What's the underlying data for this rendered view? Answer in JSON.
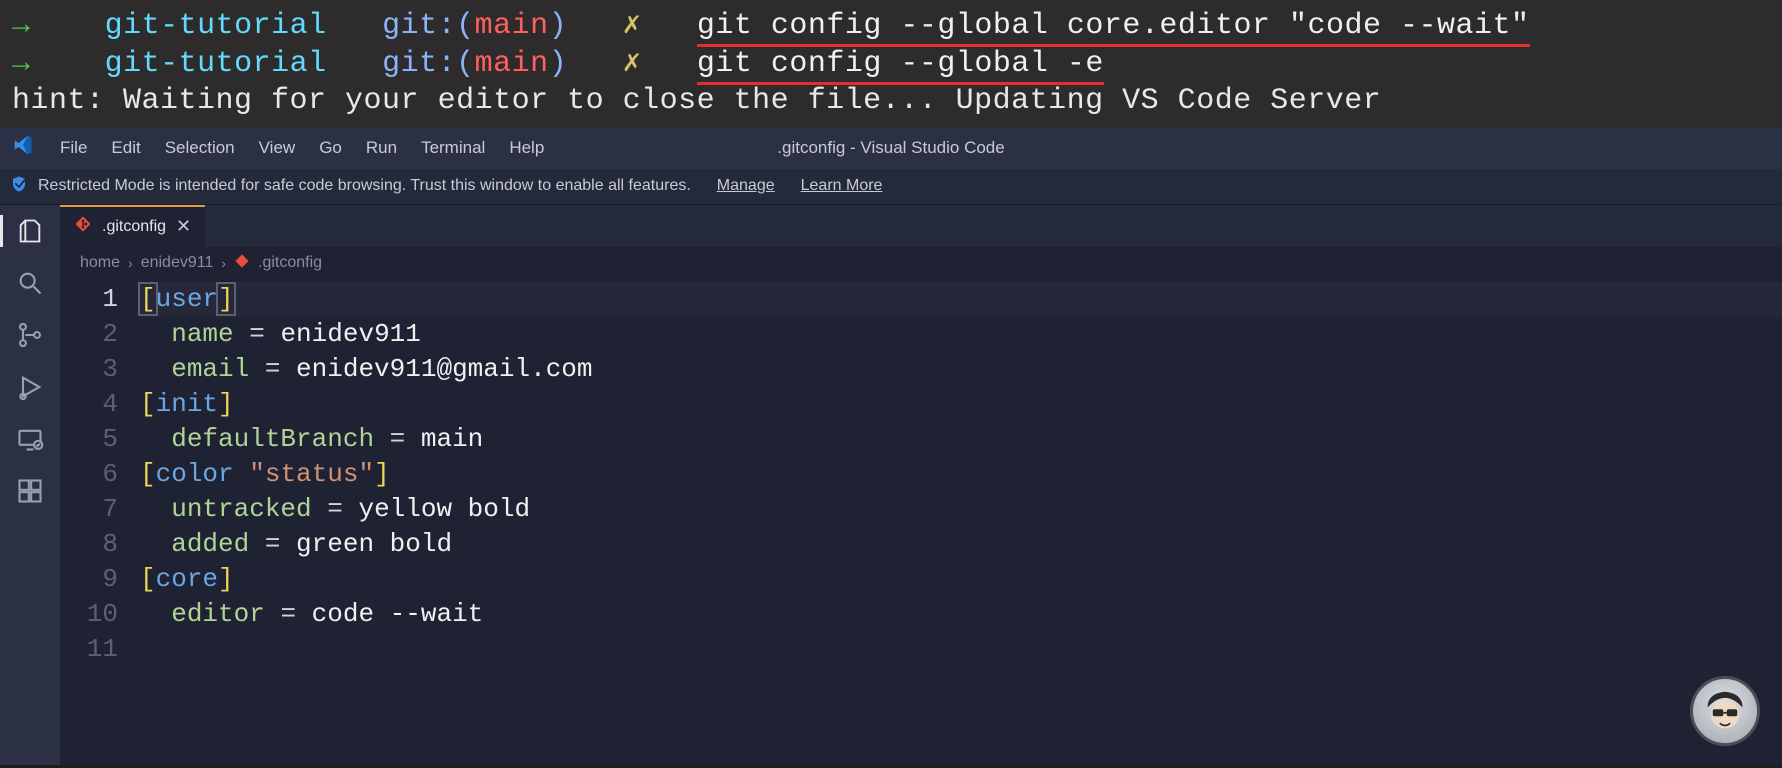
{
  "terminal": {
    "lines": [
      {
        "arrow": "→",
        "folder": "git-tutorial",
        "gitlabel": "git:(",
        "branch": "main",
        "gitclose": ")",
        "x": "✗",
        "cmd": "git config --global core.editor \"code --wait\"",
        "underlined": true
      },
      {
        "arrow": "→",
        "folder": "git-tutorial",
        "gitlabel": "git:(",
        "branch": "main",
        "gitclose": ")",
        "x": "✗",
        "cmd": "git config --global -e",
        "underlined": true
      }
    ],
    "hint": "hint: Waiting for your editor to close the file... Updating VS Code Server"
  },
  "vscode": {
    "menu": [
      "File",
      "Edit",
      "Selection",
      "View",
      "Go",
      "Run",
      "Terminal",
      "Help"
    ],
    "window_title": ".gitconfig - Visual Studio Code",
    "banner": {
      "text": "Restricted Mode is intended for safe code browsing. Trust this window to enable all features.",
      "manage": "Manage",
      "learn": "Learn More"
    },
    "tab": {
      "name": ".gitconfig"
    },
    "breadcrumb": [
      "home",
      "enidev911",
      ".gitconfig"
    ],
    "code_lines": [
      {
        "n": 1,
        "tokens": [
          {
            "c": "bracket-y cursor-bracket",
            "t": "["
          },
          {
            "c": "section",
            "t": "user"
          },
          {
            "c": "bracket-y cursor-bracket",
            "t": "]"
          }
        ]
      },
      {
        "n": 2,
        "tokens": [
          {
            "c": "",
            "t": "  "
          },
          {
            "c": "key",
            "t": "name"
          },
          {
            "c": "eq",
            "t": " = "
          },
          {
            "c": "val",
            "t": "enidev911"
          }
        ]
      },
      {
        "n": 3,
        "tokens": [
          {
            "c": "",
            "t": "  "
          },
          {
            "c": "key",
            "t": "email"
          },
          {
            "c": "eq",
            "t": " = "
          },
          {
            "c": "val",
            "t": "enidev911@gmail.com"
          }
        ]
      },
      {
        "n": 4,
        "tokens": [
          {
            "c": "bracket-y",
            "t": "["
          },
          {
            "c": "section",
            "t": "init"
          },
          {
            "c": "bracket-y",
            "t": "]"
          }
        ]
      },
      {
        "n": 5,
        "tokens": [
          {
            "c": "",
            "t": "  "
          },
          {
            "c": "key",
            "t": "defaultBranch"
          },
          {
            "c": "eq",
            "t": " = "
          },
          {
            "c": "val",
            "t": "main"
          }
        ]
      },
      {
        "n": 6,
        "tokens": [
          {
            "c": "bracket-y",
            "t": "["
          },
          {
            "c": "section",
            "t": "color"
          },
          {
            "c": "",
            "t": " "
          },
          {
            "c": "str",
            "t": "\"status\""
          },
          {
            "c": "bracket-y",
            "t": "]"
          }
        ]
      },
      {
        "n": 7,
        "tokens": [
          {
            "c": "",
            "t": "  "
          },
          {
            "c": "key",
            "t": "untracked"
          },
          {
            "c": "eq",
            "t": " = "
          },
          {
            "c": "val",
            "t": "yellow bold"
          }
        ]
      },
      {
        "n": 8,
        "tokens": [
          {
            "c": "",
            "t": "  "
          },
          {
            "c": "key",
            "t": "added"
          },
          {
            "c": "eq",
            "t": " = "
          },
          {
            "c": "val",
            "t": "green bold"
          }
        ]
      },
      {
        "n": 9,
        "tokens": [
          {
            "c": "bracket-y",
            "t": "["
          },
          {
            "c": "section",
            "t": "core"
          },
          {
            "c": "bracket-y",
            "t": "]"
          }
        ]
      },
      {
        "n": 10,
        "tokens": [
          {
            "c": "",
            "t": "  "
          },
          {
            "c": "key",
            "t": "editor"
          },
          {
            "c": "eq",
            "t": " = "
          },
          {
            "c": "val",
            "t": "code --wait"
          }
        ]
      },
      {
        "n": 11,
        "tokens": []
      }
    ]
  }
}
